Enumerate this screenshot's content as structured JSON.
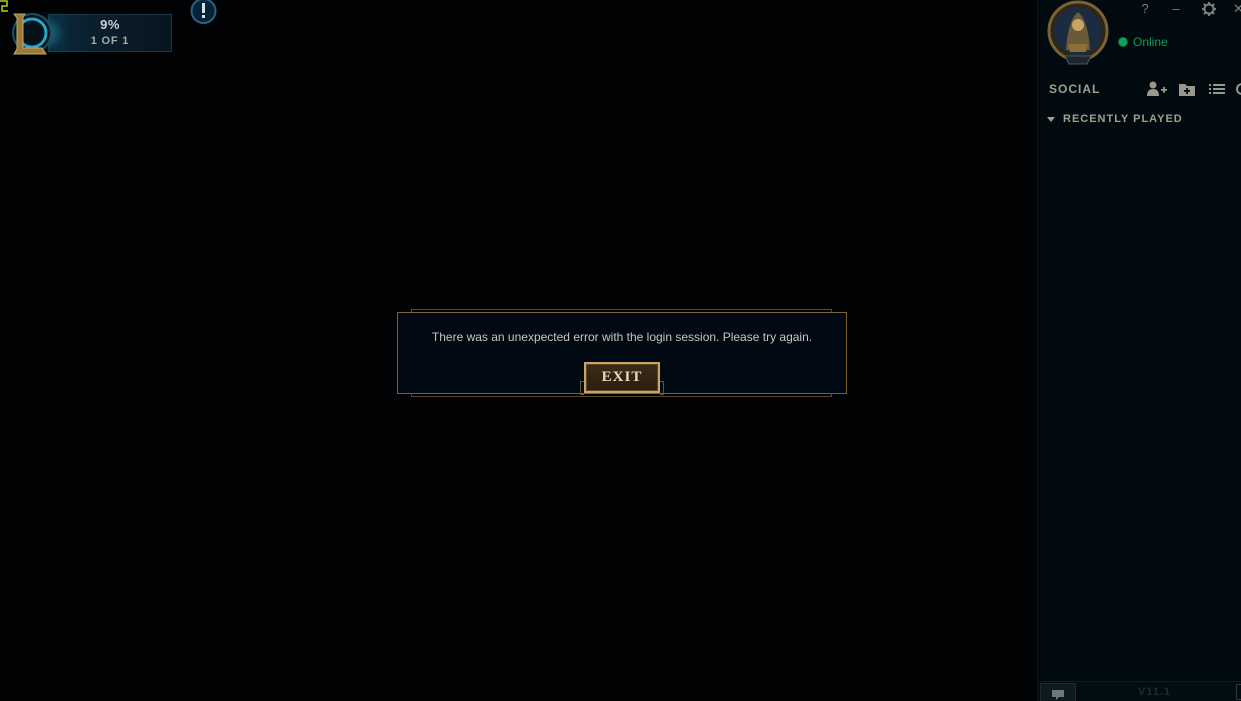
{
  "patcher": {
    "percent": "9%",
    "progress_fraction": 0.09,
    "count": "1 OF 1",
    "logo_icon": "league-logo-icon",
    "alert_icon": "exclamation-icon"
  },
  "window_controls": {
    "help": "?",
    "minimize": "–",
    "settings_icon": "gear-icon",
    "close": "✕"
  },
  "profile": {
    "status": "Online",
    "status_color": "#0ea25a"
  },
  "social": {
    "title": "SOCIAL",
    "actions": [
      "add-friend-icon",
      "add-folder-icon",
      "list-view-icon"
    ],
    "groups": [
      {
        "label": "RECENTLY PLAYED",
        "expanded": true
      }
    ]
  },
  "footer": {
    "version": "V11.1",
    "chat_icon": "chat-icon"
  },
  "modal": {
    "message": "There was an unexpected error with the login session. Please try again.",
    "exit_label": "EXIT"
  },
  "colors": {
    "gold": "#c7a665",
    "accent_blue": "#2aa4c9",
    "background": "#010204"
  }
}
